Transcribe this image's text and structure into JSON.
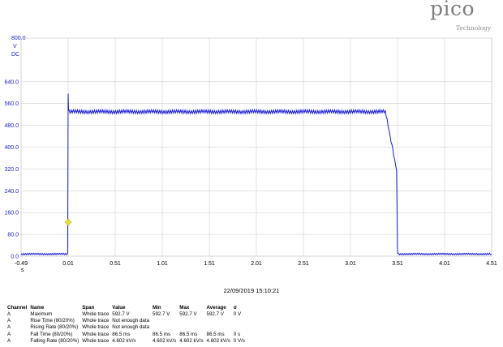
{
  "logo": {
    "word": "pico",
    "subtitle": "Technology"
  },
  "axis_units": {
    "y_top": "800.0",
    "y_unit": "V",
    "y_coupling": "DC",
    "x_unit": "s"
  },
  "timestamp": "22/09/2019 15:10:21",
  "colors": {
    "trace": "#1a1ad6",
    "axis_text": "#1c1cc8",
    "grid": "#c8c8c8",
    "marker": "#e6e03a"
  },
  "chart_data": {
    "type": "line",
    "title": "",
    "xlabel": "s",
    "ylabel": "V",
    "xlim": [
      -0.49,
      4.51
    ],
    "ylim": [
      0,
      800
    ],
    "grid": true,
    "y_ticks": [
      "0.0",
      "80.0",
      "160.0",
      "240.0",
      "320.0",
      "400.0",
      "480.0",
      "560.0",
      "640.0"
    ],
    "x_ticks": [
      "-0.49",
      "0.01",
      "0.51",
      "1.01",
      "1.51",
      "2.01",
      "2.51",
      "3.01",
      "3.51",
      "4.01",
      "4.51"
    ],
    "series": [
      {
        "x": [
          -0.49,
          0.005,
          0.01,
          0.015,
          0.02,
          3.38,
          3.4,
          3.43,
          3.46,
          3.49,
          3.5,
          3.51,
          3.52,
          4.51
        ],
        "y": [
          8,
          8,
          592.7,
          530,
          530,
          530,
          500,
          440,
          390,
          330,
          310,
          8,
          8,
          8
        ]
      }
    ],
    "trigger_marker": {
      "x": 0.01,
      "y": 125
    }
  },
  "measurements": {
    "headers": [
      "Channel",
      "Name",
      "Span",
      "Value",
      "Min",
      "Max",
      "Average",
      "σ"
    ],
    "rows": [
      [
        "A",
        "Maximum",
        "Whole trace",
        "592.7 V",
        "592.7 V",
        "592.7 V",
        "592.7 V",
        "0 V"
      ],
      [
        "A",
        "Rise Time (80/20%)",
        "Whole trace",
        "Not enough data",
        "",
        "",
        "",
        ""
      ],
      [
        "A",
        "Rising Rate (80/20%)",
        "Whole trace",
        "Not enough data",
        "",
        "",
        "",
        ""
      ],
      [
        "A",
        "Fall Time (80/20%)",
        "Whole trace",
        "86.5 ms",
        "86.5 ms",
        "86.5 ms",
        "86.5 ms",
        "0 s"
      ],
      [
        "A",
        "Falling Rate (80/20%)",
        "Whole trace",
        "4.602 kV/s",
        "4.602 kV/s",
        "4.602 kV/s",
        "4.602 kV/s",
        "0 V/s"
      ]
    ]
  }
}
